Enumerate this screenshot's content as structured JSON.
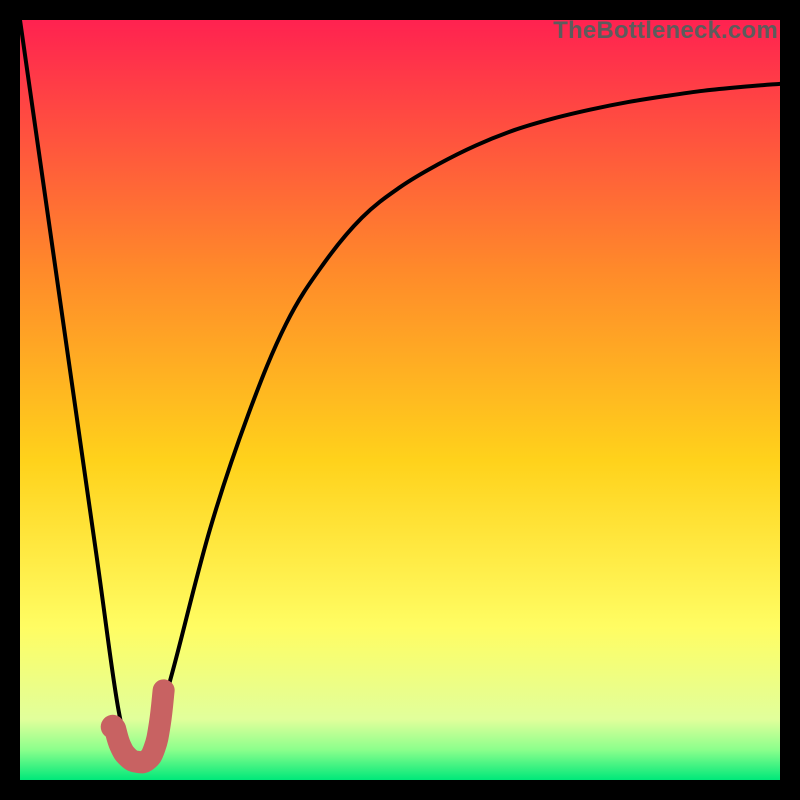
{
  "watermark": "TheBottleneck.com",
  "colors": {
    "gradient_top": "#ff2250",
    "gradient_mid1": "#ff6a2c",
    "gradient_mid2": "#ffd21b",
    "gradient_mid3": "#fffd63",
    "gradient_bottom_a": "#e1ff9b",
    "gradient_bottom_b": "#8cff8c",
    "gradient_bottom_c": "#00e87a",
    "curve": "#000000",
    "marker": "#c86262",
    "marker_stroke": "#b55353"
  },
  "chart_data": {
    "type": "line",
    "title": "",
    "xlabel": "",
    "ylabel": "",
    "xlim": [
      0,
      100
    ],
    "ylim": [
      0,
      100
    ],
    "series": [
      {
        "name": "bottleneck-curve",
        "x": [
          0,
          5,
          10,
          13,
          15,
          17,
          20,
          25,
          30,
          35,
          40,
          45,
          50,
          55,
          60,
          65,
          70,
          75,
          80,
          85,
          90,
          95,
          100
        ],
        "y": [
          100,
          65,
          30,
          9,
          3,
          4,
          14,
          33,
          48,
          60,
          68,
          74,
          78,
          81,
          83.5,
          85.5,
          87,
          88.2,
          89.2,
          90,
          90.7,
          91.2,
          91.6
        ]
      }
    ],
    "marker_path": {
      "name": "j-marker",
      "points_xy": [
        [
          12.5,
          6.8
        ],
        [
          13.2,
          4.5
        ],
        [
          14.2,
          3.0
        ],
        [
          15.4,
          2.4
        ],
        [
          16.7,
          2.6
        ],
        [
          17.7,
          4.2
        ],
        [
          18.4,
          7.4
        ],
        [
          18.9,
          11.8
        ]
      ],
      "dot_xy": [
        12.2,
        7.0
      ]
    }
  }
}
